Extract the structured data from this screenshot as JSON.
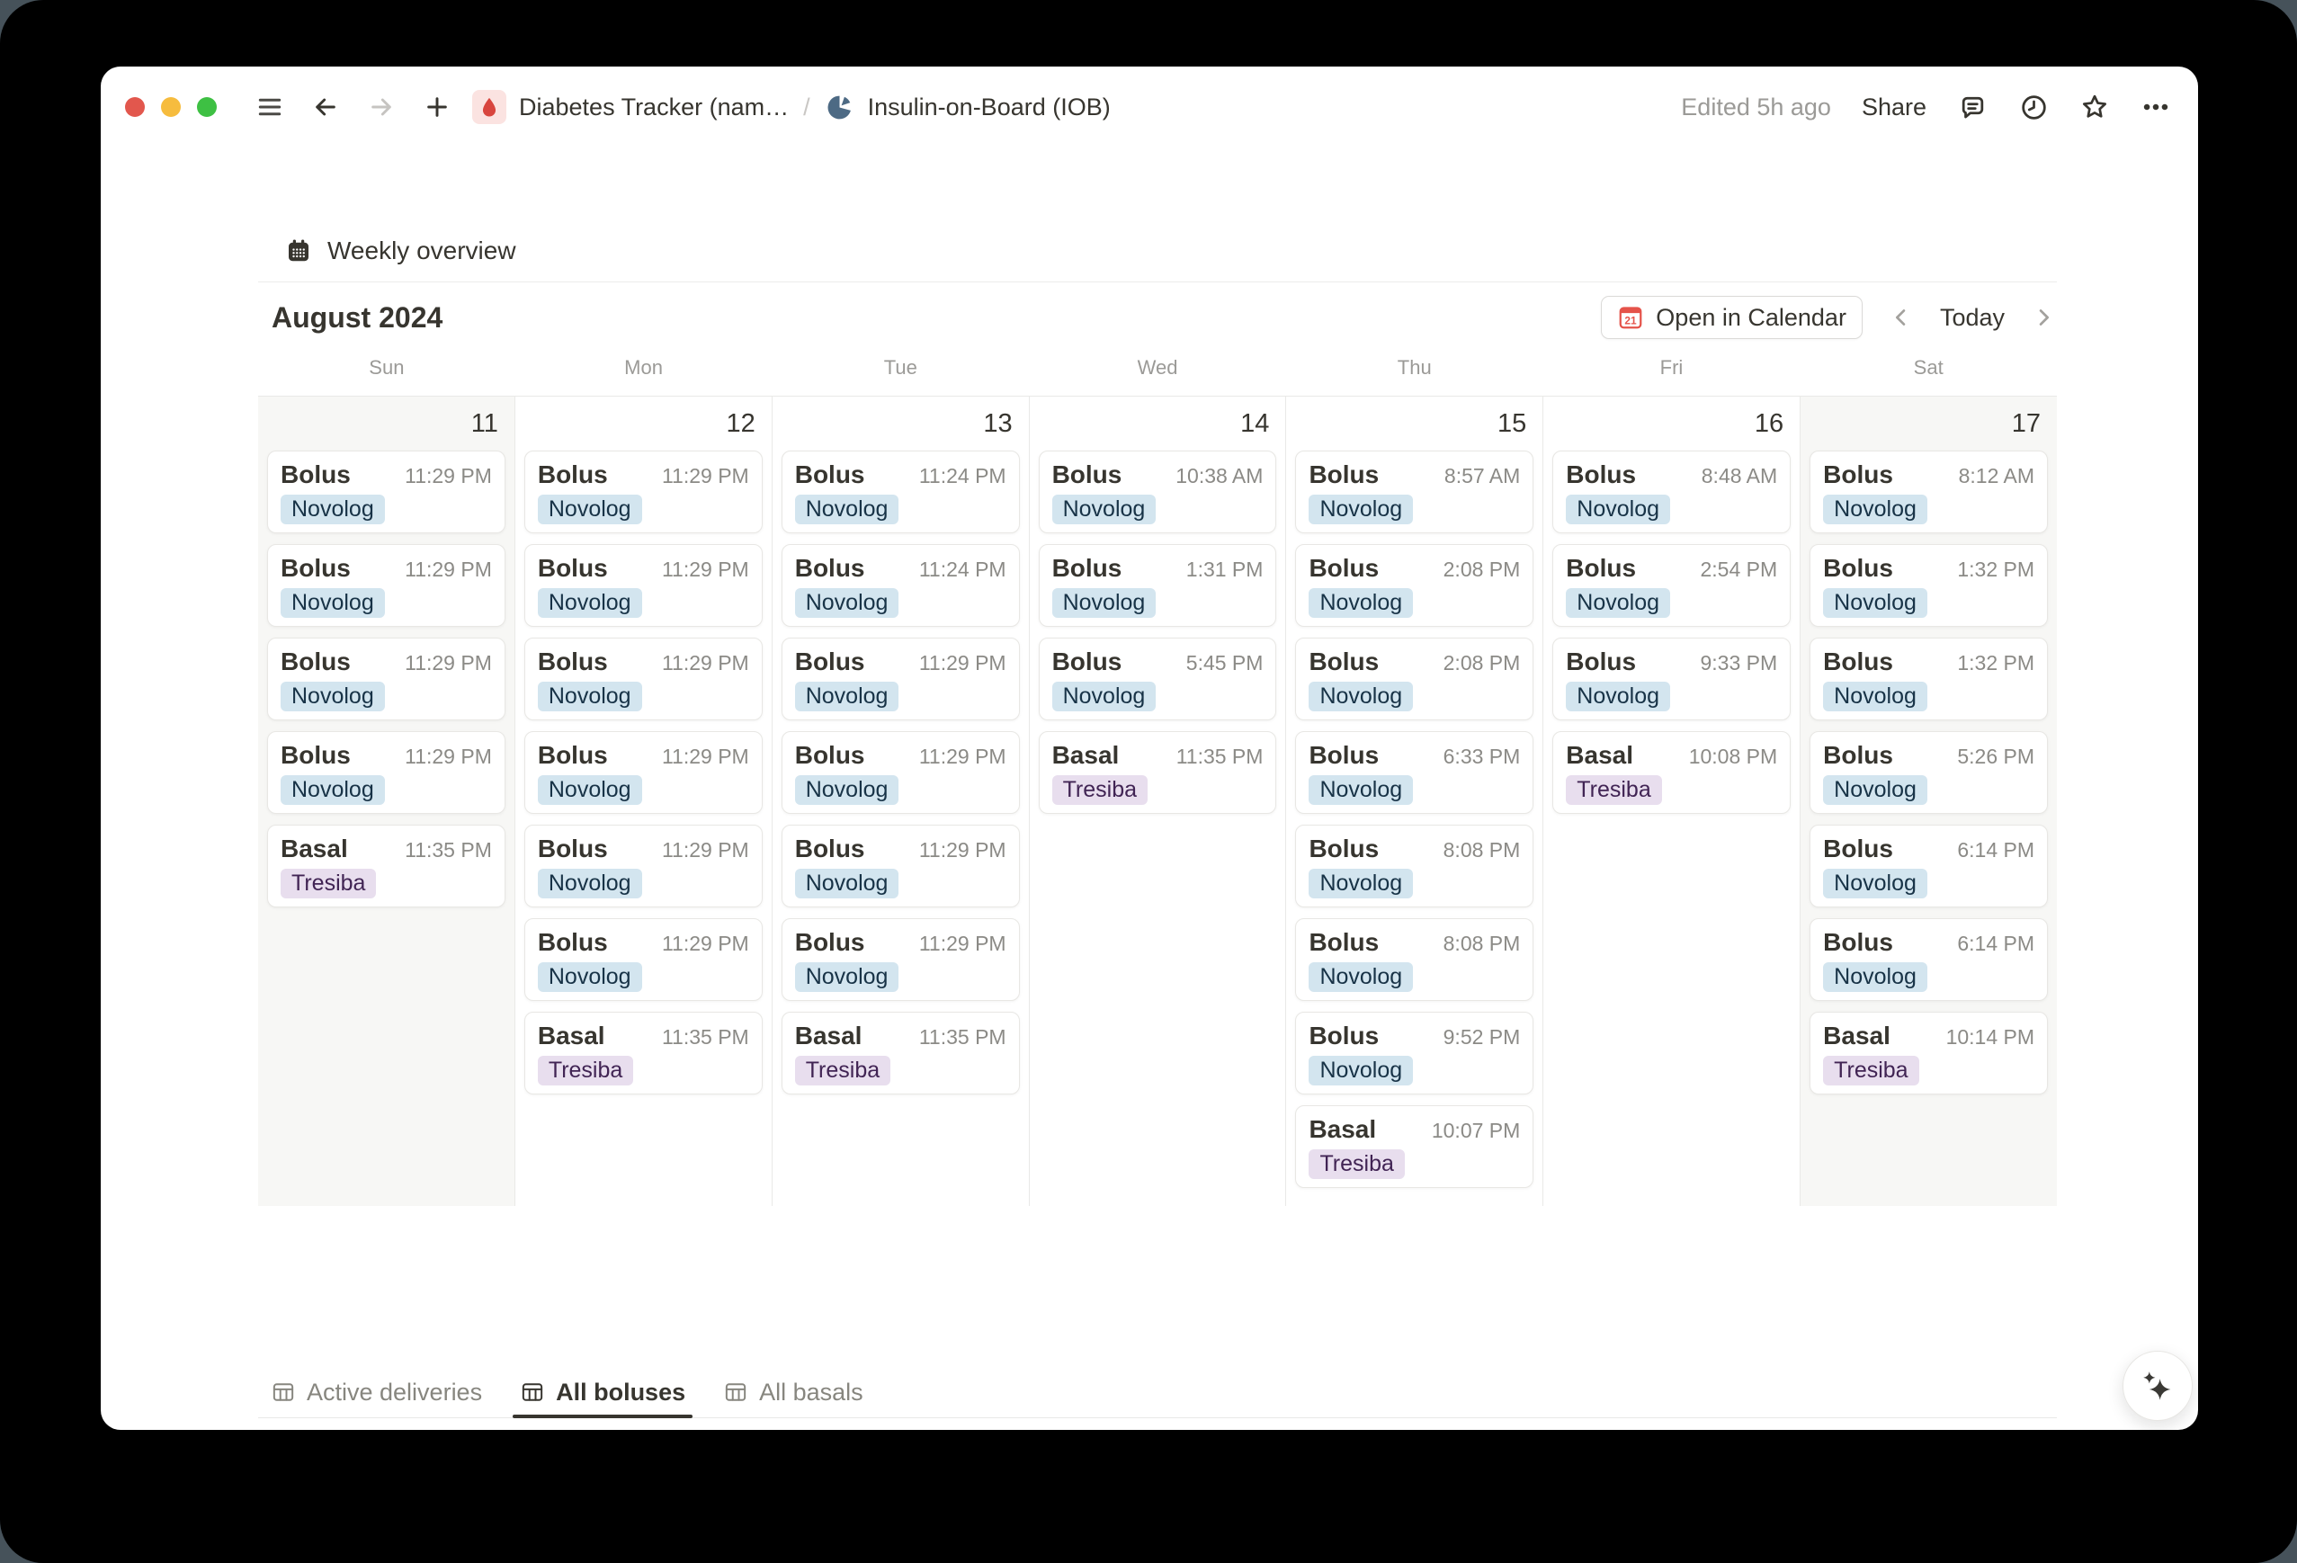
{
  "chrome": {
    "window_controls": {
      "close": "#e2574d",
      "minimize": "#f6bc3e",
      "zoom": "#3ec043"
    },
    "breadcrumb": {
      "parent": "Diabetes Tracker (nam…",
      "separator": "/",
      "current": "Insulin-on-Board (IOB)"
    },
    "edited_label": "Edited 5h ago",
    "share_label": "Share"
  },
  "view": {
    "title": "Weekly overview",
    "month_label": "August 2024",
    "open_in_calendar_label": "Open in Calendar",
    "calendar_icon_day": "21",
    "today_label": "Today"
  },
  "calendar": {
    "day_headers": [
      "Sun",
      "Mon",
      "Tue",
      "Wed",
      "Thu",
      "Fri",
      "Sat"
    ],
    "tag_styles": {
      "Novolog": {
        "bg": "#d3e5ef",
        "text": "#183347"
      },
      "Tresiba": {
        "bg": "#e8deee",
        "text": "#412454"
      }
    },
    "days": [
      {
        "date": "11",
        "weekend": true,
        "events": [
          {
            "title": "Bolus",
            "time": "11:29 PM",
            "tag": "Novolog"
          },
          {
            "title": "Bolus",
            "time": "11:29 PM",
            "tag": "Novolog"
          },
          {
            "title": "Bolus",
            "time": "11:29 PM",
            "tag": "Novolog"
          },
          {
            "title": "Bolus",
            "time": "11:29 PM",
            "tag": "Novolog"
          },
          {
            "title": "Basal",
            "time": "11:35 PM",
            "tag": "Tresiba"
          }
        ]
      },
      {
        "date": "12",
        "weekend": false,
        "events": [
          {
            "title": "Bolus",
            "time": "11:29 PM",
            "tag": "Novolog"
          },
          {
            "title": "Bolus",
            "time": "11:29 PM",
            "tag": "Novolog"
          },
          {
            "title": "Bolus",
            "time": "11:29 PM",
            "tag": "Novolog"
          },
          {
            "title": "Bolus",
            "time": "11:29 PM",
            "tag": "Novolog"
          },
          {
            "title": "Bolus",
            "time": "11:29 PM",
            "tag": "Novolog"
          },
          {
            "title": "Bolus",
            "time": "11:29 PM",
            "tag": "Novolog"
          },
          {
            "title": "Basal",
            "time": "11:35 PM",
            "tag": "Tresiba"
          }
        ]
      },
      {
        "date": "13",
        "weekend": false,
        "events": [
          {
            "title": "Bolus",
            "time": "11:24 PM",
            "tag": "Novolog"
          },
          {
            "title": "Bolus",
            "time": "11:24 PM",
            "tag": "Novolog"
          },
          {
            "title": "Bolus",
            "time": "11:29 PM",
            "tag": "Novolog"
          },
          {
            "title": "Bolus",
            "time": "11:29 PM",
            "tag": "Novolog"
          },
          {
            "title": "Bolus",
            "time": "11:29 PM",
            "tag": "Novolog"
          },
          {
            "title": "Bolus",
            "time": "11:29 PM",
            "tag": "Novolog"
          },
          {
            "title": "Basal",
            "time": "11:35 PM",
            "tag": "Tresiba"
          }
        ]
      },
      {
        "date": "14",
        "weekend": false,
        "events": [
          {
            "title": "Bolus",
            "time": "10:38 AM",
            "tag": "Novolog"
          },
          {
            "title": "Bolus",
            "time": "1:31 PM",
            "tag": "Novolog"
          },
          {
            "title": "Bolus",
            "time": "5:45 PM",
            "tag": "Novolog"
          },
          {
            "title": "Basal",
            "time": "11:35 PM",
            "tag": "Tresiba"
          }
        ]
      },
      {
        "date": "15",
        "weekend": false,
        "events": [
          {
            "title": "Bolus",
            "time": "8:57 AM",
            "tag": "Novolog"
          },
          {
            "title": "Bolus",
            "time": "2:08 PM",
            "tag": "Novolog"
          },
          {
            "title": "Bolus",
            "time": "2:08 PM",
            "tag": "Novolog"
          },
          {
            "title": "Bolus",
            "time": "6:33 PM",
            "tag": "Novolog"
          },
          {
            "title": "Bolus",
            "time": "8:08 PM",
            "tag": "Novolog"
          },
          {
            "title": "Bolus",
            "time": "8:08 PM",
            "tag": "Novolog"
          },
          {
            "title": "Bolus",
            "time": "9:52 PM",
            "tag": "Novolog"
          },
          {
            "title": "Basal",
            "time": "10:07 PM",
            "tag": "Tresiba"
          }
        ]
      },
      {
        "date": "16",
        "weekend": false,
        "events": [
          {
            "title": "Bolus",
            "time": "8:48 AM",
            "tag": "Novolog"
          },
          {
            "title": "Bolus",
            "time": "2:54 PM",
            "tag": "Novolog"
          },
          {
            "title": "Bolus",
            "time": "9:33 PM",
            "tag": "Novolog"
          },
          {
            "title": "Basal",
            "time": "10:08 PM",
            "tag": "Tresiba"
          }
        ]
      },
      {
        "date": "17",
        "weekend": true,
        "events": [
          {
            "title": "Bolus",
            "time": "8:12 AM",
            "tag": "Novolog"
          },
          {
            "title": "Bolus",
            "time": "1:32 PM",
            "tag": "Novolog"
          },
          {
            "title": "Bolus",
            "time": "1:32 PM",
            "tag": "Novolog"
          },
          {
            "title": "Bolus",
            "time": "5:26 PM",
            "tag": "Novolog"
          },
          {
            "title": "Bolus",
            "time": "6:14 PM",
            "tag": "Novolog"
          },
          {
            "title": "Bolus",
            "time": "6:14 PM",
            "tag": "Novolog"
          },
          {
            "title": "Basal",
            "time": "10:14 PM",
            "tag": "Tresiba"
          }
        ]
      }
    ]
  },
  "tabs": [
    {
      "label": "Active deliveries",
      "active": false
    },
    {
      "label": "All boluses",
      "active": true
    },
    {
      "label": "All basals",
      "active": false
    }
  ],
  "ai_button_icon": "sparkles"
}
